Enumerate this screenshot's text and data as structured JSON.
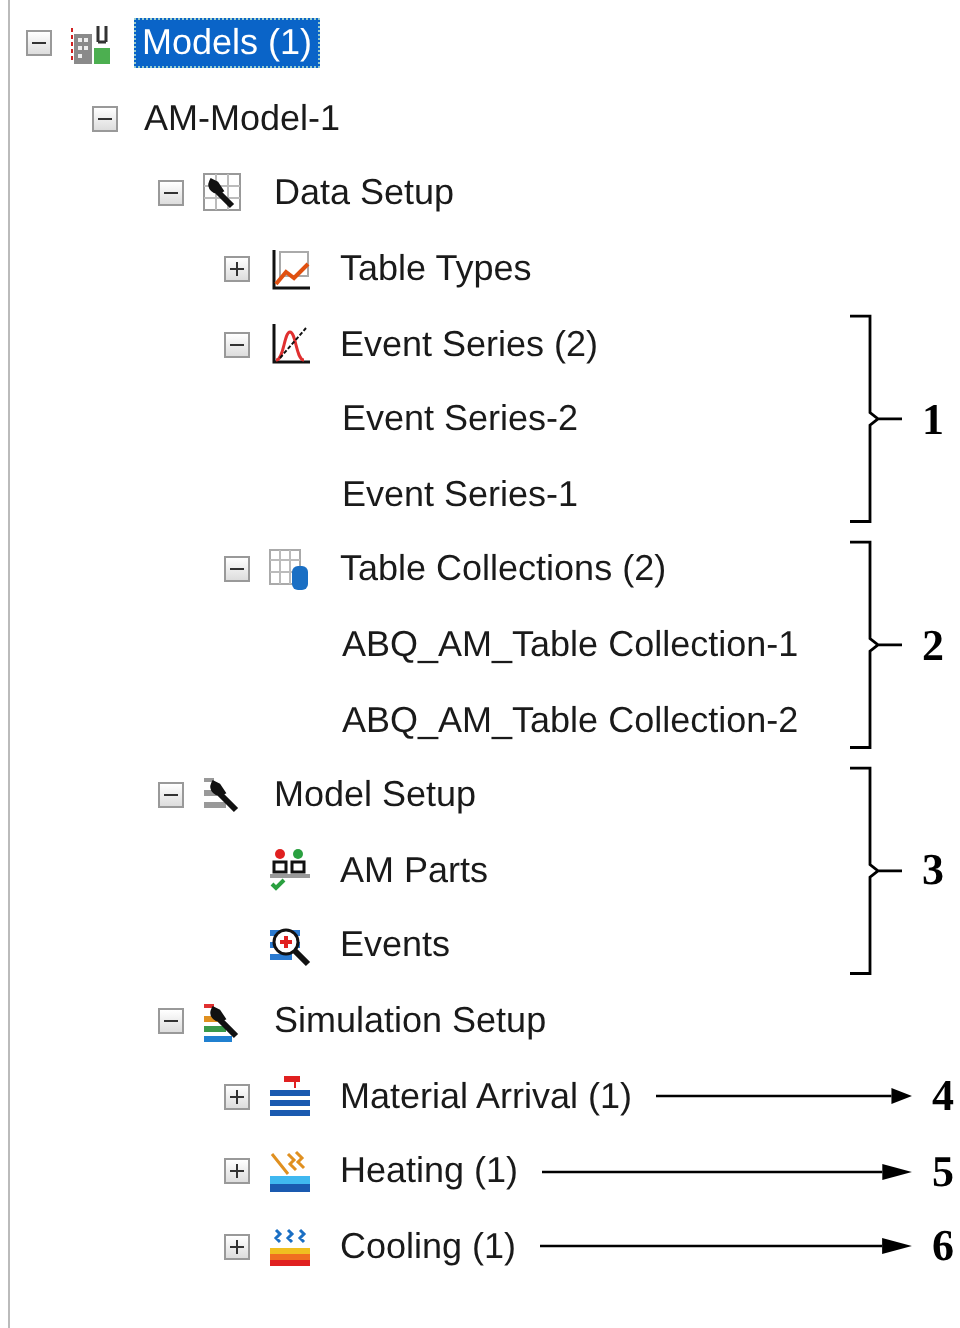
{
  "tree": [
    {
      "label": "Models (1)",
      "kind": "assembly",
      "selected": true,
      "expanded": true,
      "children": [
        {
          "label": "AM-Model-1",
          "kind": "none",
          "selected": false,
          "expanded": true,
          "children": [
            {
              "label": "Data Setup",
              "kind": "data-setup",
              "selected": false,
              "expanded": true,
              "children": [
                {
                  "label": "Table Types",
                  "kind": "chart",
                  "selected": false,
                  "expanded": false
                },
                {
                  "label": "Event Series (2)",
                  "kind": "curve",
                  "selected": false,
                  "expanded": true,
                  "callout": {
                    "kind": "brace",
                    "label": "1"
                  },
                  "children": [
                    {
                      "label": "Event Series-2",
                      "kind": "none",
                      "selected": false
                    },
                    {
                      "label": "Event Series-1",
                      "kind": "none",
                      "selected": false
                    }
                  ]
                },
                {
                  "label": "Table Collections (2)",
                  "kind": "table-db",
                  "selected": false,
                  "expanded": true,
                  "callout": {
                    "kind": "brace",
                    "label": "2"
                  },
                  "children": [
                    {
                      "label": "ABQ_AM_Table Collection-1",
                      "kind": "none",
                      "selected": false
                    },
                    {
                      "label": "ABQ_AM_Table Collection-2",
                      "kind": "none",
                      "selected": false
                    }
                  ]
                }
              ]
            },
            {
              "label": "Model Setup",
              "kind": "model-setup",
              "selected": false,
              "expanded": true,
              "callout": {
                "kind": "brace",
                "label": "3"
              },
              "children": [
                {
                  "label": "AM Parts",
                  "kind": "parts",
                  "selected": false
                },
                {
                  "label": "Events",
                  "kind": "events",
                  "selected": false
                }
              ]
            },
            {
              "label": "Simulation Setup",
              "kind": "sim-setup",
              "selected": false,
              "expanded": true,
              "children": [
                {
                  "label": "Material Arrival (1)",
                  "kind": "layers",
                  "selected": false,
                  "expanded": false,
                  "callout": {
                    "kind": "arrow",
                    "label": "4"
                  }
                },
                {
                  "label": "Heating (1)",
                  "kind": "heating",
                  "selected": false,
                  "expanded": false,
                  "callout": {
                    "kind": "arrow",
                    "label": "5"
                  }
                },
                {
                  "label": "Cooling (1)",
                  "kind": "cooling",
                  "selected": false,
                  "expanded": false,
                  "callout": {
                    "kind": "arrow",
                    "label": "6"
                  }
                }
              ]
            }
          ]
        }
      ]
    }
  ]
}
